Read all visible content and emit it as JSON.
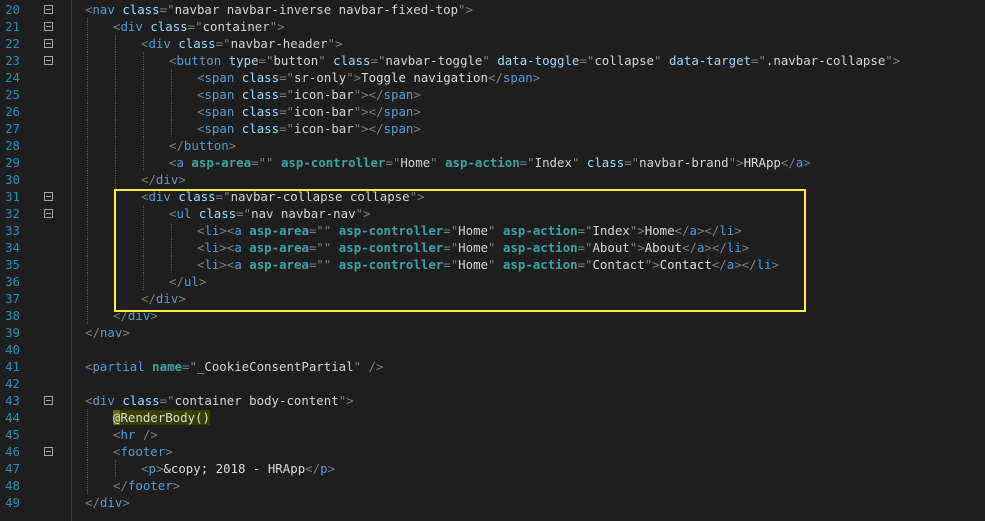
{
  "editor": {
    "highlight_color": "#ffeb3b",
    "lines": [
      {
        "num": "20",
        "fold": true,
        "indent": 0,
        "tokens": [
          [
            "punc",
            "<"
          ],
          [
            "tag",
            "nav"
          ],
          [
            "txt",
            " "
          ],
          [
            "attr",
            "class"
          ],
          [
            "punc",
            "=\""
          ],
          [
            "str",
            "navbar navbar-inverse navbar-fixed-top"
          ],
          [
            "punc",
            "\">"
          ]
        ]
      },
      {
        "num": "21",
        "fold": true,
        "indent": 1,
        "tokens": [
          [
            "punc",
            "<"
          ],
          [
            "tag",
            "div"
          ],
          [
            "txt",
            " "
          ],
          [
            "attr",
            "class"
          ],
          [
            "punc",
            "=\""
          ],
          [
            "str",
            "container"
          ],
          [
            "punc",
            "\">"
          ]
        ]
      },
      {
        "num": "22",
        "fold": true,
        "indent": 2,
        "tokens": [
          [
            "punc",
            "<"
          ],
          [
            "tag",
            "div"
          ],
          [
            "txt",
            " "
          ],
          [
            "attr",
            "class"
          ],
          [
            "punc",
            "=\""
          ],
          [
            "str",
            "navbar-header"
          ],
          [
            "punc",
            "\">"
          ]
        ]
      },
      {
        "num": "23",
        "fold": true,
        "indent": 3,
        "tokens": [
          [
            "punc",
            "<"
          ],
          [
            "tag",
            "button"
          ],
          [
            "txt",
            " "
          ],
          [
            "attr",
            "type"
          ],
          [
            "punc",
            "=\""
          ],
          [
            "str",
            "button"
          ],
          [
            "punc",
            "\""
          ],
          [
            "txt",
            " "
          ],
          [
            "attr",
            "class"
          ],
          [
            "punc",
            "=\""
          ],
          [
            "str",
            "navbar-toggle"
          ],
          [
            "punc",
            "\""
          ],
          [
            "txt",
            " "
          ],
          [
            "attr",
            "data-toggle"
          ],
          [
            "punc",
            "=\""
          ],
          [
            "str",
            "collapse"
          ],
          [
            "punc",
            "\""
          ],
          [
            "txt",
            " "
          ],
          [
            "attr",
            "data-target"
          ],
          [
            "punc",
            "=\""
          ],
          [
            "str",
            ".navbar-collapse"
          ],
          [
            "punc",
            "\">"
          ]
        ]
      },
      {
        "num": "24",
        "fold": false,
        "indent": 4,
        "tokens": [
          [
            "punc",
            "<"
          ],
          [
            "tag",
            "span"
          ],
          [
            "txt",
            " "
          ],
          [
            "attr",
            "class"
          ],
          [
            "punc",
            "=\""
          ],
          [
            "str",
            "sr-only"
          ],
          [
            "punc",
            "\">"
          ],
          [
            "txt",
            "Toggle navigation"
          ],
          [
            "punc",
            "</"
          ],
          [
            "tag",
            "span"
          ],
          [
            "punc",
            ">"
          ]
        ]
      },
      {
        "num": "25",
        "fold": false,
        "indent": 4,
        "tokens": [
          [
            "punc",
            "<"
          ],
          [
            "tag",
            "span"
          ],
          [
            "txt",
            " "
          ],
          [
            "attr",
            "class"
          ],
          [
            "punc",
            "=\""
          ],
          [
            "str",
            "icon-bar"
          ],
          [
            "punc",
            "\"></"
          ],
          [
            "tag",
            "span"
          ],
          [
            "punc",
            ">"
          ]
        ]
      },
      {
        "num": "26",
        "fold": false,
        "indent": 4,
        "tokens": [
          [
            "punc",
            "<"
          ],
          [
            "tag",
            "span"
          ],
          [
            "txt",
            " "
          ],
          [
            "attr",
            "class"
          ],
          [
            "punc",
            "=\""
          ],
          [
            "str",
            "icon-bar"
          ],
          [
            "punc",
            "\"></"
          ],
          [
            "tag",
            "span"
          ],
          [
            "punc",
            ">"
          ]
        ]
      },
      {
        "num": "27",
        "fold": false,
        "indent": 4,
        "tokens": [
          [
            "punc",
            "<"
          ],
          [
            "tag",
            "span"
          ],
          [
            "txt",
            " "
          ],
          [
            "attr",
            "class"
          ],
          [
            "punc",
            "=\""
          ],
          [
            "str",
            "icon-bar"
          ],
          [
            "punc",
            "\"></"
          ],
          [
            "tag",
            "span"
          ],
          [
            "punc",
            ">"
          ]
        ]
      },
      {
        "num": "28",
        "fold": false,
        "indent": 3,
        "tokens": [
          [
            "punc",
            "</"
          ],
          [
            "tag",
            "button"
          ],
          [
            "punc",
            ">"
          ]
        ]
      },
      {
        "num": "29",
        "fold": false,
        "indent": 3,
        "tokens": [
          [
            "punc",
            "<"
          ],
          [
            "tag",
            "a"
          ],
          [
            "txt",
            " "
          ],
          [
            "tagh",
            "asp-area"
          ],
          [
            "punc",
            "=\"\""
          ],
          [
            "txt",
            " "
          ],
          [
            "tagh",
            "asp-controller"
          ],
          [
            "punc",
            "=\""
          ],
          [
            "str",
            "Home"
          ],
          [
            "punc",
            "\""
          ],
          [
            "txt",
            " "
          ],
          [
            "tagh",
            "asp-action"
          ],
          [
            "punc",
            "=\""
          ],
          [
            "str",
            "Index"
          ],
          [
            "punc",
            "\""
          ],
          [
            "txt",
            " "
          ],
          [
            "attr",
            "class"
          ],
          [
            "punc",
            "=\""
          ],
          [
            "str",
            "navbar-brand"
          ],
          [
            "punc",
            "\">"
          ],
          [
            "txt",
            "HRApp"
          ],
          [
            "punc",
            "</"
          ],
          [
            "tag",
            "a"
          ],
          [
            "punc",
            ">"
          ]
        ]
      },
      {
        "num": "30",
        "fold": false,
        "indent": 2,
        "tokens": [
          [
            "punc",
            "</"
          ],
          [
            "tag",
            "div"
          ],
          [
            "punc",
            ">"
          ]
        ]
      },
      {
        "num": "31",
        "fold": true,
        "indent": 2,
        "tokens": [
          [
            "punc",
            "<"
          ],
          [
            "tag",
            "div"
          ],
          [
            "txt",
            " "
          ],
          [
            "attr",
            "class"
          ],
          [
            "punc",
            "=\""
          ],
          [
            "str",
            "navbar-collapse collapse"
          ],
          [
            "punc",
            "\">"
          ]
        ]
      },
      {
        "num": "32",
        "fold": true,
        "indent": 3,
        "tokens": [
          [
            "punc",
            "<"
          ],
          [
            "tag",
            "ul"
          ],
          [
            "txt",
            " "
          ],
          [
            "attr",
            "class"
          ],
          [
            "punc",
            "=\""
          ],
          [
            "str",
            "nav navbar-nav"
          ],
          [
            "punc",
            "\">"
          ]
        ]
      },
      {
        "num": "33",
        "fold": false,
        "indent": 4,
        "tokens": [
          [
            "punc",
            "<"
          ],
          [
            "tag",
            "li"
          ],
          [
            "punc",
            "><"
          ],
          [
            "tag",
            "a"
          ],
          [
            "txt",
            " "
          ],
          [
            "tagh",
            "asp-area"
          ],
          [
            "punc",
            "=\"\""
          ],
          [
            "txt",
            " "
          ],
          [
            "tagh",
            "asp-controller"
          ],
          [
            "punc",
            "=\""
          ],
          [
            "str",
            "Home"
          ],
          [
            "punc",
            "\""
          ],
          [
            "txt",
            " "
          ],
          [
            "tagh",
            "asp-action"
          ],
          [
            "punc",
            "=\""
          ],
          [
            "str",
            "Index"
          ],
          [
            "punc",
            "\">"
          ],
          [
            "txt",
            "Home"
          ],
          [
            "punc",
            "</"
          ],
          [
            "tag",
            "a"
          ],
          [
            "punc",
            "></"
          ],
          [
            "tag",
            "li"
          ],
          [
            "punc",
            ">"
          ]
        ]
      },
      {
        "num": "34",
        "fold": false,
        "indent": 4,
        "tokens": [
          [
            "punc",
            "<"
          ],
          [
            "tag",
            "li"
          ],
          [
            "punc",
            "><"
          ],
          [
            "tag",
            "a"
          ],
          [
            "txt",
            " "
          ],
          [
            "tagh",
            "asp-area"
          ],
          [
            "punc",
            "=\"\""
          ],
          [
            "txt",
            " "
          ],
          [
            "tagh",
            "asp-controller"
          ],
          [
            "punc",
            "=\""
          ],
          [
            "str",
            "Home"
          ],
          [
            "punc",
            "\""
          ],
          [
            "txt",
            " "
          ],
          [
            "tagh",
            "asp-action"
          ],
          [
            "punc",
            "=\""
          ],
          [
            "str",
            "About"
          ],
          [
            "punc",
            "\">"
          ],
          [
            "txt",
            "About"
          ],
          [
            "punc",
            "</"
          ],
          [
            "tag",
            "a"
          ],
          [
            "punc",
            "></"
          ],
          [
            "tag",
            "li"
          ],
          [
            "punc",
            ">"
          ]
        ]
      },
      {
        "num": "35",
        "fold": false,
        "indent": 4,
        "tokens": [
          [
            "punc",
            "<"
          ],
          [
            "tag",
            "li"
          ],
          [
            "punc",
            "><"
          ],
          [
            "tag",
            "a"
          ],
          [
            "txt",
            " "
          ],
          [
            "tagh",
            "asp-area"
          ],
          [
            "punc",
            "=\"\""
          ],
          [
            "txt",
            " "
          ],
          [
            "tagh",
            "asp-controller"
          ],
          [
            "punc",
            "=\""
          ],
          [
            "str",
            "Home"
          ],
          [
            "punc",
            "\""
          ],
          [
            "txt",
            " "
          ],
          [
            "tagh",
            "asp-action"
          ],
          [
            "punc",
            "=\""
          ],
          [
            "str",
            "Contact"
          ],
          [
            "punc",
            "\">"
          ],
          [
            "txt",
            "Contact"
          ],
          [
            "punc",
            "</"
          ],
          [
            "tag",
            "a"
          ],
          [
            "punc",
            "></"
          ],
          [
            "tag",
            "li"
          ],
          [
            "punc",
            ">"
          ]
        ]
      },
      {
        "num": "36",
        "fold": false,
        "indent": 3,
        "tokens": [
          [
            "punc",
            "</"
          ],
          [
            "tag",
            "ul"
          ],
          [
            "punc",
            ">"
          ]
        ]
      },
      {
        "num": "37",
        "fold": false,
        "indent": 2,
        "tokens": [
          [
            "punc",
            "</"
          ],
          [
            "tag",
            "div"
          ],
          [
            "punc",
            ">"
          ]
        ]
      },
      {
        "num": "38",
        "fold": false,
        "indent": 1,
        "tokens": [
          [
            "punc",
            "</"
          ],
          [
            "tag",
            "div"
          ],
          [
            "punc",
            ">"
          ]
        ]
      },
      {
        "num": "39",
        "fold": false,
        "indent": 0,
        "tokens": [
          [
            "punc",
            "</"
          ],
          [
            "tag",
            "nav"
          ],
          [
            "punc",
            ">"
          ]
        ]
      },
      {
        "num": "40",
        "fold": false,
        "indent": 0,
        "tokens": []
      },
      {
        "num": "41",
        "fold": false,
        "indent": 0,
        "tokens": [
          [
            "punc",
            "<"
          ],
          [
            "tag",
            "partial"
          ],
          [
            "txt",
            " "
          ],
          [
            "tagh",
            "name"
          ],
          [
            "punc",
            "=\""
          ],
          [
            "str",
            "_CookieConsentPartial"
          ],
          [
            "punc",
            "\""
          ],
          [
            "txt",
            " "
          ],
          [
            "punc",
            "/>"
          ]
        ]
      },
      {
        "num": "42",
        "fold": false,
        "indent": 0,
        "tokens": []
      },
      {
        "num": "43",
        "fold": true,
        "indent": 0,
        "tokens": [
          [
            "punc",
            "<"
          ],
          [
            "tag",
            "div"
          ],
          [
            "txt",
            " "
          ],
          [
            "attr",
            "class"
          ],
          [
            "punc",
            "=\""
          ],
          [
            "str",
            "container body-content"
          ],
          [
            "punc",
            "\">"
          ]
        ]
      },
      {
        "num": "44",
        "fold": false,
        "indent": 1,
        "tokens": [
          [
            "razor-at",
            "@"
          ],
          [
            "razor",
            "RenderBody()"
          ]
        ]
      },
      {
        "num": "45",
        "fold": false,
        "indent": 1,
        "tokens": [
          [
            "punc",
            "<"
          ],
          [
            "tag",
            "hr"
          ],
          [
            "txt",
            " "
          ],
          [
            "punc",
            "/>"
          ]
        ]
      },
      {
        "num": "46",
        "fold": true,
        "indent": 1,
        "tokens": [
          [
            "punc",
            "<"
          ],
          [
            "tag",
            "footer"
          ],
          [
            "punc",
            ">"
          ]
        ]
      },
      {
        "num": "47",
        "fold": false,
        "indent": 2,
        "tokens": [
          [
            "punc",
            "<"
          ],
          [
            "tag",
            "p"
          ],
          [
            "punc",
            ">"
          ],
          [
            "ent",
            "&copy;"
          ],
          [
            "txt",
            " 2018 - HRApp"
          ],
          [
            "punc",
            "</"
          ],
          [
            "tag",
            "p"
          ],
          [
            "punc",
            ">"
          ]
        ]
      },
      {
        "num": "48",
        "fold": false,
        "indent": 1,
        "tokens": [
          [
            "punc",
            "</"
          ],
          [
            "tag",
            "footer"
          ],
          [
            "punc",
            ">"
          ]
        ]
      },
      {
        "num": "49",
        "fold": false,
        "indent": 0,
        "tokens": [
          [
            "punc",
            "</"
          ],
          [
            "tag",
            "div"
          ],
          [
            "punc",
            ">"
          ]
        ]
      }
    ]
  }
}
